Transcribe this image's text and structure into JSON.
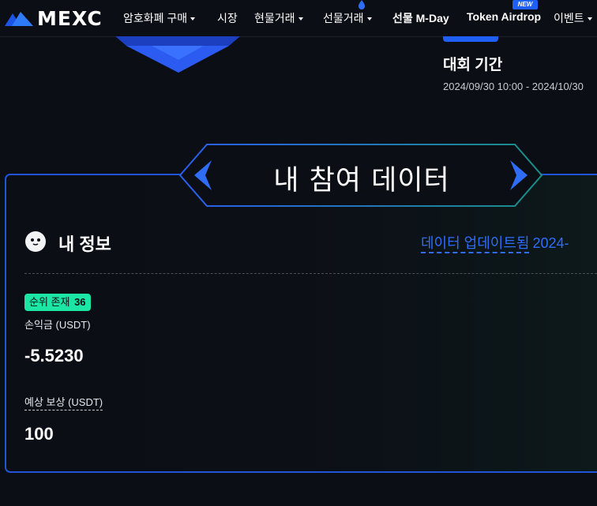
{
  "nav": {
    "logo_text": "MEXC",
    "items": [
      {
        "label": "암호화폐 구매",
        "dropdown": true
      },
      {
        "label": "시장",
        "dropdown": false
      },
      {
        "label": "현물거래",
        "dropdown": true
      },
      {
        "label": "선물거래",
        "dropdown": true
      },
      {
        "label": "선물 M-Day",
        "dropdown": false
      },
      {
        "label": "Token Airdrop",
        "dropdown": false
      },
      {
        "label": "이벤트",
        "dropdown": true
      }
    ],
    "new_badge": "NEW"
  },
  "competition": {
    "period_title": "대회 기간",
    "period_range": "2024/09/30 10:00 - 2024/10/30"
  },
  "my_data": {
    "banner_title": "내 참여 데이터",
    "info_title": "내 정보",
    "updated_label": "데이터 업데이트됨",
    "updated_date": "2024-",
    "rank_label": "순위 존재",
    "rank_value": "36",
    "pnl_label": "손익금 (USDT)",
    "pnl_value": "-5.5230",
    "reward_label": "예상 보상 (USDT)",
    "reward_value": "100"
  },
  "colors": {
    "background": "#0b0e14",
    "accent_blue": "#2154d8",
    "link_blue": "#2f6df6",
    "badge_green": "#1ce6a4",
    "banner_teal": "#1a8f86"
  }
}
